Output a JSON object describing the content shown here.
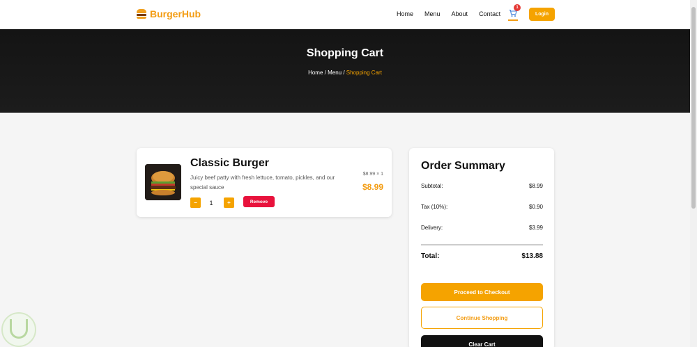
{
  "brand": {
    "name": "BurgerHub"
  },
  "nav": {
    "links": [
      "Home",
      "Menu",
      "About",
      "Contact"
    ],
    "cart_count": "1",
    "login_label": "Login"
  },
  "hero": {
    "title": "Shopping Cart",
    "breadcrumb": {
      "home": "Home",
      "sep1": " / ",
      "menu": "Menu",
      "sep2": " / ",
      "current": "Shopping Cart"
    }
  },
  "cart_item": {
    "name": "Classic Burger",
    "description": "Juicy beef patty with fresh lettuce, tomato, pickles, and our special sauce",
    "quantity": "1",
    "minus_label": "−",
    "plus_label": "+",
    "remove_label": "Remove",
    "unit_price": "$8.99 × 1",
    "line_total": "$8.99"
  },
  "summary": {
    "title": "Order Summary",
    "rows": [
      {
        "label": "Subtotal:",
        "value": "$8.99"
      },
      {
        "label": "Tax (10%):",
        "value": "$0.90"
      },
      {
        "label": "Delivery:",
        "value": "$3.99"
      }
    ],
    "total_label": "Total:",
    "total_value": "$13.88",
    "checkout_label": "Proceed to Checkout",
    "continue_label": "Continue Shopping",
    "clear_label": "Clear Cart"
  },
  "colors": {
    "accent": "#f5a300",
    "danger": "#e8123c",
    "hero_bg": "#141414"
  }
}
